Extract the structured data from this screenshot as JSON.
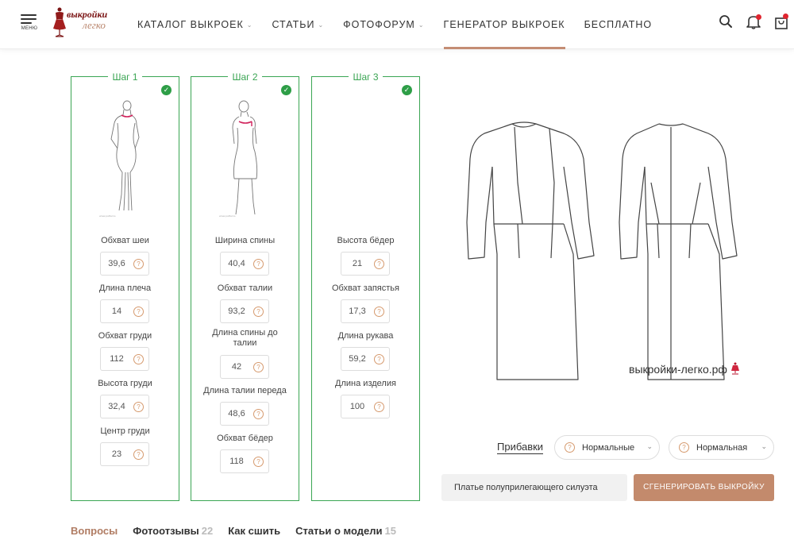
{
  "header": {
    "menu_label": "МЕНЮ",
    "logo_line1": "выкройки",
    "logo_line2": "легко",
    "nav": [
      {
        "label": "КАТАЛОГ ВЫКРОЕК",
        "dropdown": true
      },
      {
        "label": "СТАТЬИ",
        "dropdown": true
      },
      {
        "label": "ФОТОФОРУМ",
        "dropdown": true
      },
      {
        "label": "ГЕНЕРАТОР ВЫКРОЕК",
        "dropdown": false,
        "active": true
      },
      {
        "label": "БЕСПЛАТНО",
        "dropdown": false
      }
    ],
    "icons": [
      "search-icon",
      "bell-icon",
      "bag-icon"
    ]
  },
  "steps": [
    {
      "title": "Шаг 1",
      "fields": [
        {
          "label": "Обхват шеи",
          "value": "39,6"
        },
        {
          "label": "Длина плеча",
          "value": "14"
        },
        {
          "label": "Обхват груди",
          "value": "112"
        },
        {
          "label": "Высота груди",
          "value": "32,4"
        },
        {
          "label": "Центр груди",
          "value": "23"
        }
      ]
    },
    {
      "title": "Шаг 2",
      "fields": [
        {
          "label": "Ширина спины",
          "value": "40,4"
        },
        {
          "label": "Обхват талии",
          "value": "93,2"
        },
        {
          "label": "Длина спины до талии",
          "value": "42"
        },
        {
          "label": "Длина талии переда",
          "value": "48,6"
        },
        {
          "label": "Обхват бёдер",
          "value": "118"
        }
      ]
    },
    {
      "title": "Шаг 3",
      "fields": [
        {
          "label": "Высота бёдер",
          "value": "21"
        },
        {
          "label": "Обхват запястья",
          "value": "17,3"
        },
        {
          "label": "Длина рукава",
          "value": "59,2"
        },
        {
          "label": "Длина изделия",
          "value": "100"
        }
      ]
    }
  ],
  "question_mark": "?",
  "preview": {
    "watermark": "выкройки-легко.рф"
  },
  "controls": {
    "allowances_link": "Прибавки",
    "select1_value": "Нормальные",
    "select2_value": "Нормальная",
    "model_name": "Платье полуприлегающего силуэта",
    "generate_button": "СГЕНЕРИРОВАТЬ ВЫКРОЙКУ"
  },
  "tabs": [
    {
      "label": "Вопросы",
      "count": "",
      "active": true
    },
    {
      "label": "Фотоотзывы",
      "count": "22",
      "active": false
    },
    {
      "label": "Как сшить",
      "count": "",
      "active": false
    },
    {
      "label": "Статьи о модели",
      "count": "15",
      "active": false
    }
  ],
  "colors": {
    "accent": "#c48d74",
    "green": "#3aa553",
    "red": "#e0252f"
  }
}
